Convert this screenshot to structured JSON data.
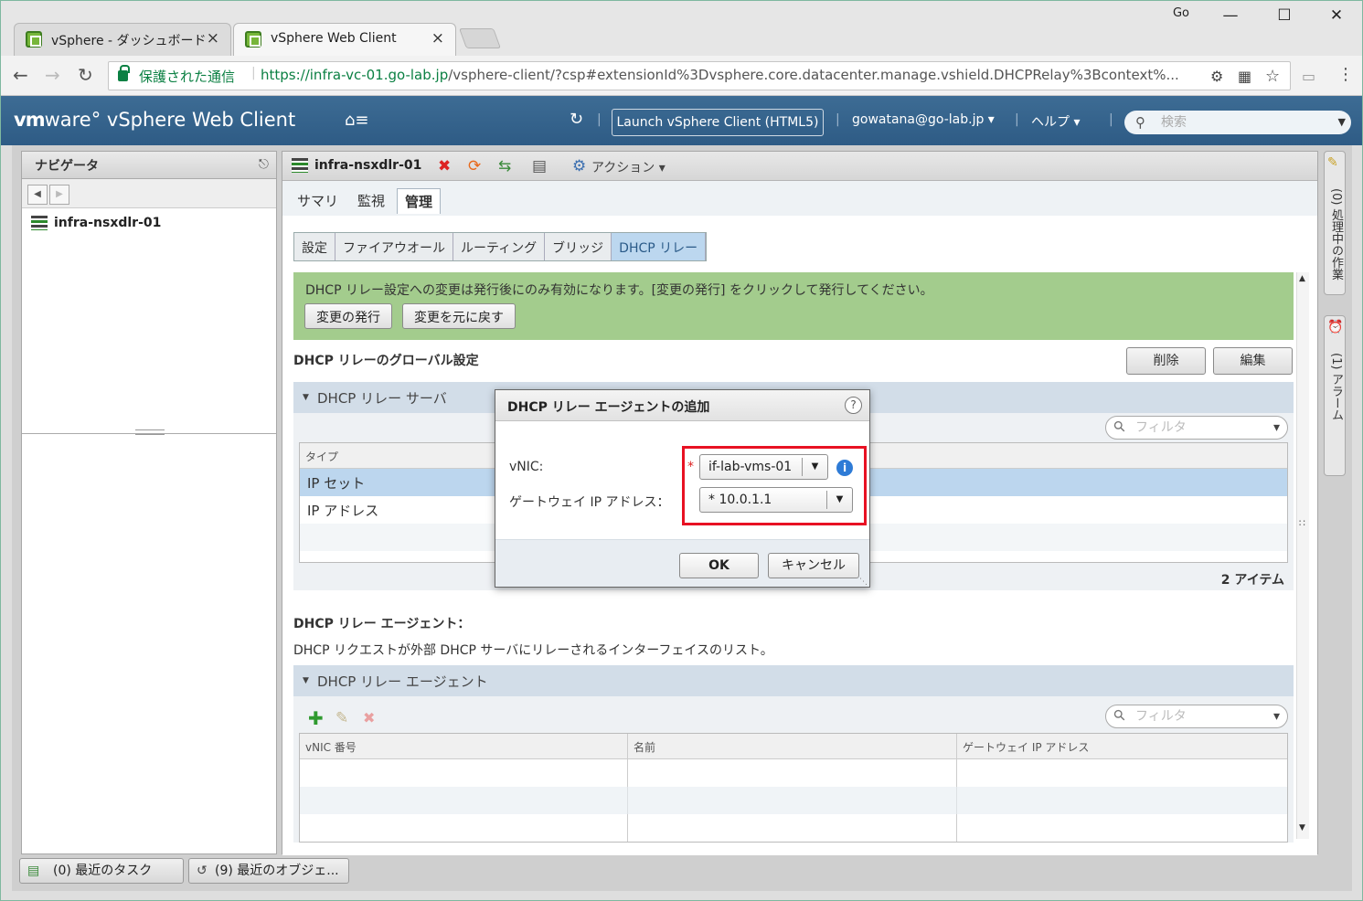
{
  "browser": {
    "tabs": [
      {
        "title": "vSphere - ダッシュボード",
        "close": "×"
      },
      {
        "title": "vSphere Web Client",
        "close": "×"
      }
    ],
    "profile_badge": "Go",
    "secure_label": "保護された通信",
    "url_host": "https://infra-vc-01.go-lab.jp",
    "url_rest": "/vsphere-client/?csp#extensionId%3Dvsphere.core.datacenter.manage.vshield.DHCPRelay%3Bcontext%..."
  },
  "header": {
    "brand_vm": "vm",
    "brand_rest": "ware° vSphere Web Client",
    "launch_html5": "Launch vSphere Client (HTML5)",
    "user": "gowatana@go-lab.jp ▾",
    "help": "ヘルプ ▾",
    "search_placeholder": "検索",
    "sep": "|"
  },
  "navigator": {
    "title": "ナビゲータ",
    "item": "infra-nsxdlr-01"
  },
  "object": {
    "name": "infra-nsxdlr-01",
    "actions_label": "アクション ▾",
    "tabs": [
      "サマリ",
      "監視",
      "管理"
    ],
    "subtabs": [
      "設定",
      "ファイアウオール",
      "ルーティング",
      "ブリッジ",
      "DHCP リレー"
    ]
  },
  "notice": {
    "text": "DHCP リレー設定への変更は発行後にのみ有効になります。[変更の発行] をクリックして発行してください。",
    "publish": "変更の発行",
    "revert": "変更を元に戻す"
  },
  "global": {
    "title": "DHCP リレーのグローバル設定",
    "delete": "削除",
    "edit": "編集",
    "server_section": "DHCP リレー サーバ",
    "filter": "フィルタ",
    "col_type": "タイプ",
    "rows": [
      "IP セット",
      "IP アドレス"
    ],
    "count": "2 アイテム"
  },
  "agents": {
    "title": "DHCP リレー エージェント：",
    "desc": "DHCP リクエストが外部 DHCP サーバにリレーされるインターフェイスのリスト。",
    "section": "DHCP リレー エージェント",
    "filter": "フィルタ",
    "columns": [
      "vNIC 番号",
      "名前",
      "ゲートウェイ IP アドレス"
    ]
  },
  "dock": {
    "tasks": "(0) 処理中の作業",
    "alarms": "(1) アラーム"
  },
  "bottom": {
    "recent_tasks": "(0) 最近のタスク",
    "recent_objects": "(9) 最近のオブジェ..."
  },
  "dialog": {
    "title": "DHCP リレー エージェントの追加",
    "help": "?",
    "vnic_label": "vNIC:",
    "vnic_value": "if-lab-vms-01",
    "required_mark": "*",
    "gw_label": "ゲートウェイ IP アドレス：",
    "gw_value": "* 10.0.1.1",
    "info": "i",
    "ok": "OK",
    "cancel": "キャンセル"
  }
}
